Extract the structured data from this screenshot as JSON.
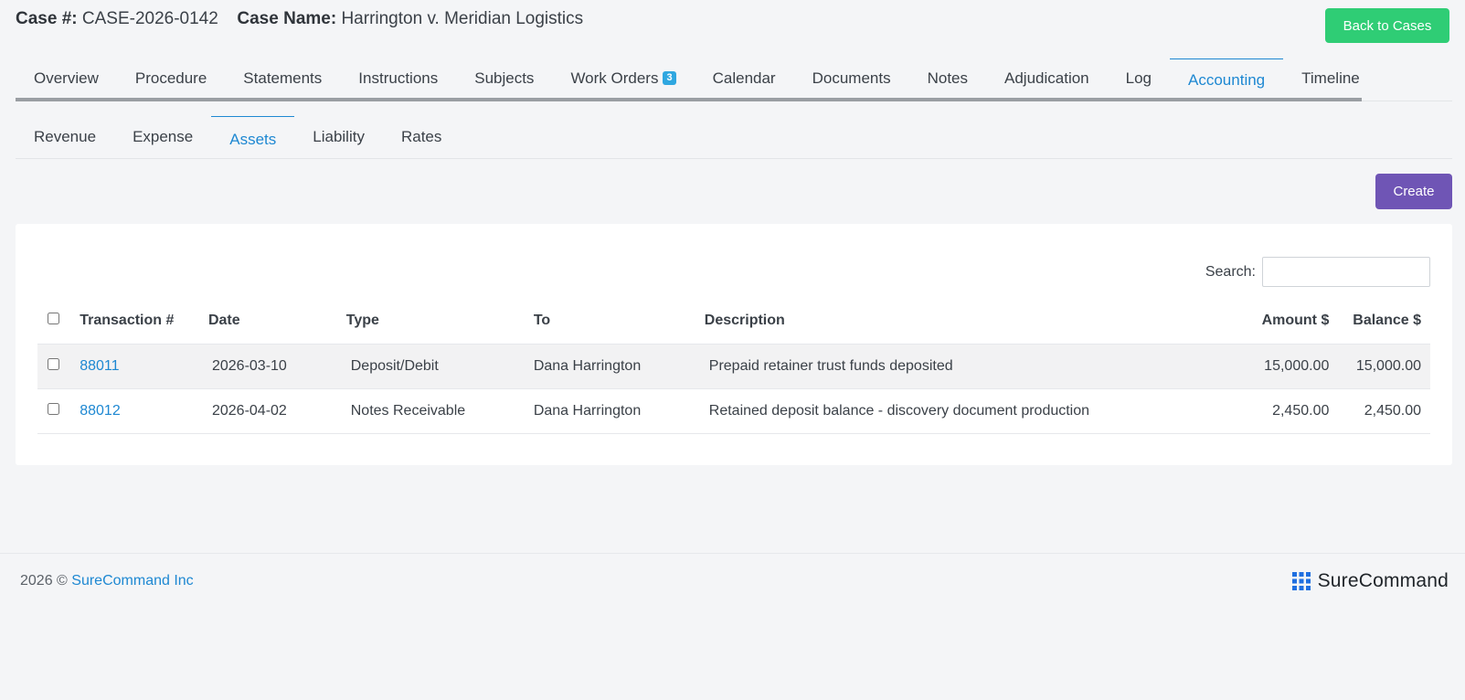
{
  "header": {
    "case_no_label": "Case #:",
    "case_no": "CASE-2026-0142",
    "case_name_label": "Case Name:",
    "case_name": "Harrington v. Meridian Logistics",
    "back_button": "Back to Cases"
  },
  "tabs": [
    {
      "label": "Overview"
    },
    {
      "label": "Procedure"
    },
    {
      "label": "Statements"
    },
    {
      "label": "Instructions"
    },
    {
      "label": "Subjects"
    },
    {
      "label": "Work Orders",
      "badge": "3"
    },
    {
      "label": "Calendar"
    },
    {
      "label": "Documents"
    },
    {
      "label": "Notes"
    },
    {
      "label": "Adjudication"
    },
    {
      "label": "Log"
    },
    {
      "label": "Accounting",
      "active": true
    },
    {
      "label": "Timeline"
    }
  ],
  "subtabs": [
    {
      "label": "Revenue"
    },
    {
      "label": "Expense"
    },
    {
      "label": "Assets",
      "active": true
    },
    {
      "label": "Liability"
    },
    {
      "label": "Rates"
    }
  ],
  "toolbar": {
    "create_button": "Create"
  },
  "search": {
    "label": "Search:",
    "value": ""
  },
  "table": {
    "columns": [
      "Transaction #",
      "Date",
      "Type",
      "To",
      "Description",
      "Amount $",
      "Balance $"
    ],
    "rows": [
      {
        "transaction": "88011",
        "date": "2026-03-10",
        "type": "Deposit/Debit",
        "to": "Dana Harrington",
        "description": "Prepaid retainer trust funds deposited",
        "amount": "15,000.00",
        "balance": "15,000.00"
      },
      {
        "transaction": "88012",
        "date": "2026-04-02",
        "type": "Notes Receivable",
        "to": "Dana Harrington",
        "description": "Retained deposit balance - discovery document production",
        "amount": "2,450.00",
        "balance": "2,450.00"
      }
    ]
  },
  "footer": {
    "copyright": "2026 ©",
    "company": "SureCommand Inc",
    "brand": "SureCommand",
    "brand_icon": "grid-logo-icon",
    "accent_color": "#1e88d2"
  }
}
